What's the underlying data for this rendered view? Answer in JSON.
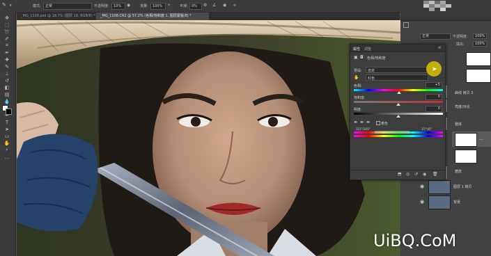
{
  "options_bar": {
    "mode_label": "模式:",
    "mode_value": "正常",
    "opacity_label": "不透明度:",
    "opacity_value": "10%",
    "flow_label": "流量:",
    "flow_value": "100%",
    "smooth_label": "平滑:",
    "smooth_value": "0%"
  },
  "tabs": [
    {
      "label": "_MG_1108.psd @ 18.7% (图层 18, RGB/8) *",
      "active": false
    },
    {
      "label": "_MG_1108.CR2 @ 57.2% (色相/饱和度 1, 图层蒙版/8) *",
      "active": true
    }
  ],
  "properties": {
    "tab_props": "属性",
    "tab_adjust": "调整",
    "panel_title": "色相/饱和度",
    "preset_label": "预设:",
    "preset_value": "自定",
    "channel_value": "红色",
    "hue_label": "色相:",
    "hue_value": "+5",
    "hue_pos": 0.51,
    "sat_label": "饱和度:",
    "sat_value": "0",
    "sat_pos": 0.5,
    "light_label": "明度:",
    "light_value": "0",
    "light_pos": 0.5,
    "colorize_label": "着色",
    "range_left": "315°/345°",
    "range_right": "15°\\45°"
  },
  "right_panel": {
    "blend_value": "正常",
    "opacity_label": "不透明度:",
    "opacity_value": "100%",
    "fill_label": "填充:",
    "fill_value": "100%"
  },
  "layers": [
    {
      "name": "",
      "kind": "white"
    },
    {
      "name": "",
      "kind": "white"
    },
    {
      "name": "曲线 拷贝 3",
      "kind": "group"
    },
    {
      "name": "亮度/对比",
      "kind": "group"
    },
    {
      "name": "整体",
      "kind": "group"
    },
    {
      "name": "",
      "kind": "white"
    },
    {
      "name": "",
      "kind": "white"
    },
    {
      "name": "磨皮",
      "kind": "group"
    },
    {
      "name": "图层 1 拷贝",
      "kind": "photo"
    },
    {
      "name": "背景",
      "kind": "photo"
    }
  ],
  "watermark": "UiBQ.CoM",
  "colors": {
    "ui_dark": "#3c3c3c",
    "ui_panel": "#424242",
    "cursor_highlight": "#d9c300"
  }
}
